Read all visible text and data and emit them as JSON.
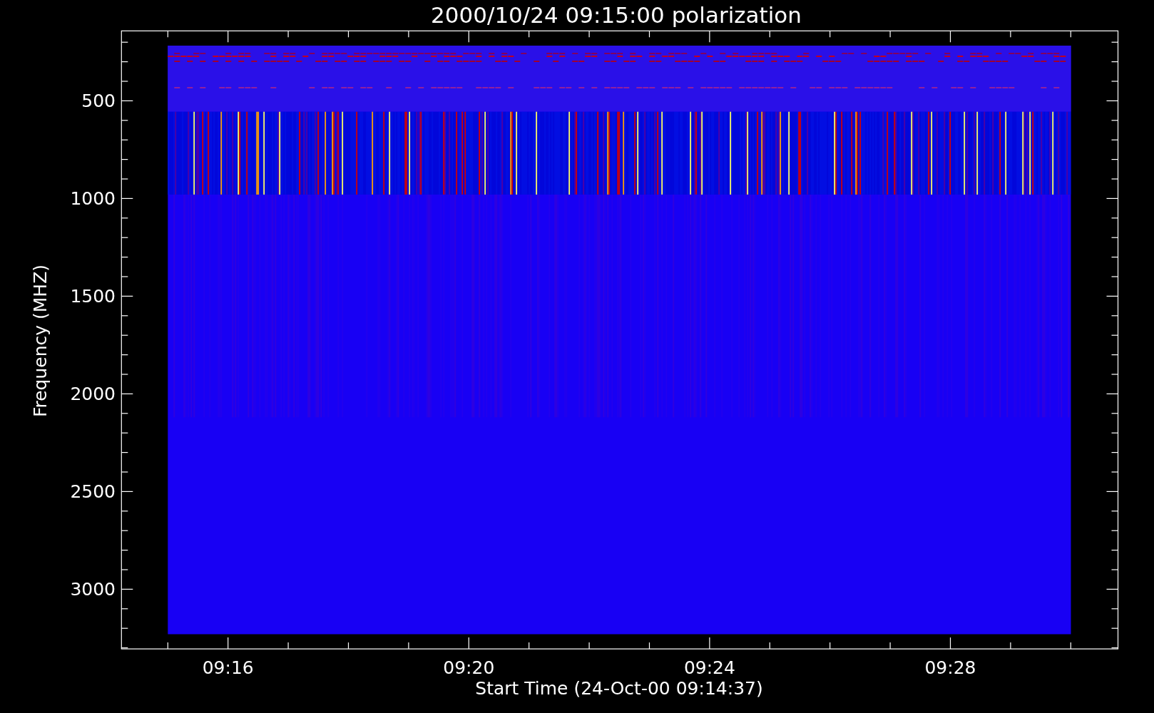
{
  "title": "2000/10/24 09:15:00 polarization",
  "y_axis": {
    "label": "Frequency (MHZ)",
    "ticks": [
      "500",
      "1000",
      "1500",
      "2000",
      "2500",
      "3000"
    ]
  },
  "x_axis": {
    "label": "Start Time (24-Oct-00 09:14:37)",
    "ticks": [
      "09:16",
      "09:20",
      "09:24",
      "09:28"
    ]
  }
}
